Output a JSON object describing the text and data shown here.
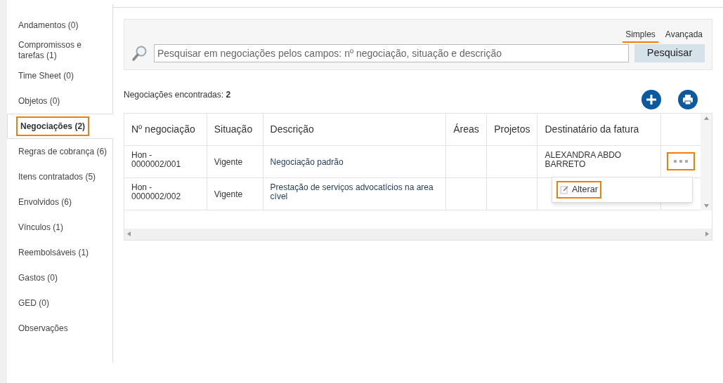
{
  "sidebar": {
    "items": [
      {
        "label": "Andamentos",
        "count": "(0)",
        "selected": false
      },
      {
        "label": "Compromissos e tarefas",
        "count": "(1)",
        "selected": false
      },
      {
        "label": "Time Sheet",
        "count": "(0)",
        "selected": false
      },
      {
        "label": "Objetos",
        "count": "(0)",
        "selected": false
      },
      {
        "label": "Negociações",
        "count": "(2)",
        "selected": true
      },
      {
        "label": "Regras de cobrança",
        "count": "(6)",
        "selected": false
      },
      {
        "label": "Itens contratados",
        "count": "(5)",
        "selected": false
      },
      {
        "label": "Envolvidos",
        "count": "(6)",
        "selected": false
      },
      {
        "label": "Vínculos",
        "count": "(1)",
        "selected": false
      },
      {
        "label": "Reembolsáveis",
        "count": "(1)",
        "selected": false
      },
      {
        "label": "Gastos",
        "count": "(0)",
        "selected": false
      },
      {
        "label": "GED",
        "count": "(0)",
        "selected": false
      },
      {
        "label": "Observações",
        "selected": false
      }
    ]
  },
  "search": {
    "modes": [
      {
        "label": "Simples",
        "selected": true
      },
      {
        "label": "Avançada",
        "selected": false
      }
    ],
    "placeholder": "Pesquisar em negociações pelos campos: nº negociação, situação e descrição",
    "button": "Pesquisar"
  },
  "results": {
    "label": "Negociações encontradas:",
    "count": "2"
  },
  "table": {
    "columns": [
      "Nº negociação",
      "Situação",
      "Descrição",
      "Áreas",
      "Projetos",
      "Destinatário da fatura"
    ],
    "rows": [
      {
        "cells": [
          "Hon - 0000002/001",
          "Vigente",
          "Negociação padrão",
          "",
          "",
          "ALEXANDRA ABDO BARRETO"
        ],
        "more_button": {
          "highlighted": true
        }
      },
      {
        "cells": [
          "Hon - 0000002/002",
          "Vigente",
          "Prestação de serviços advocatícios na area cível",
          "",
          "",
          ""
        ]
      }
    ]
  },
  "row_menu": {
    "items": [
      {
        "label": "Alterar",
        "highlighted": true
      }
    ]
  }
}
